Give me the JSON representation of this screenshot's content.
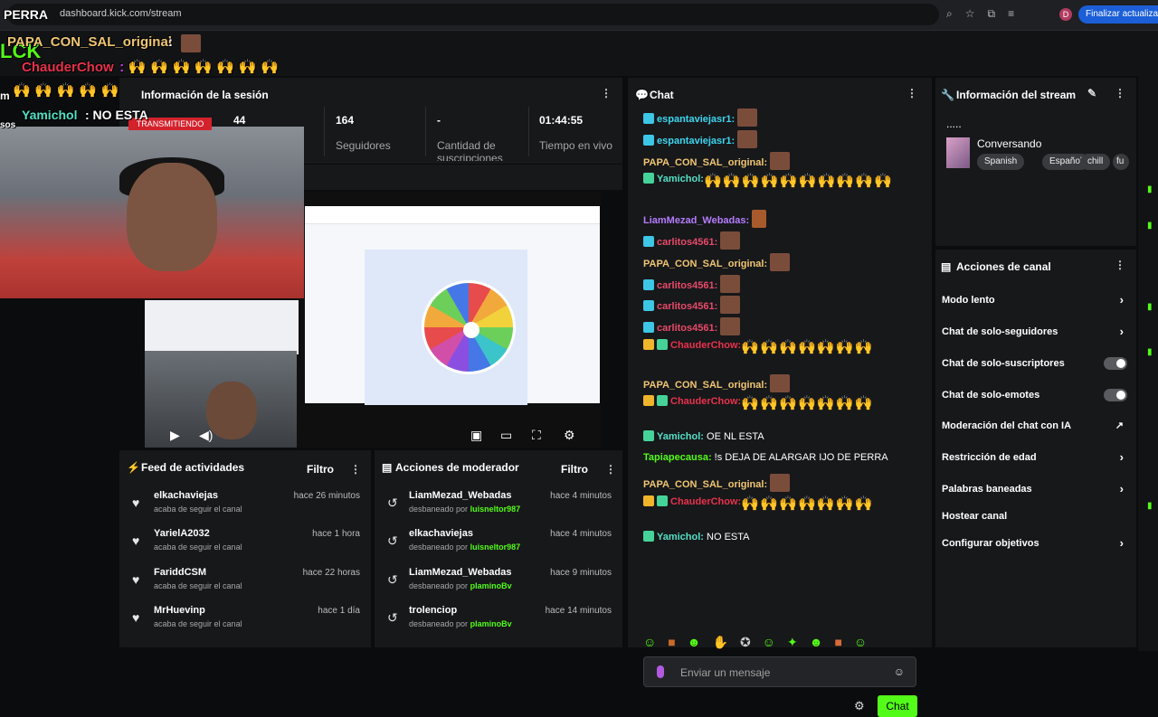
{
  "browser": {
    "url": "dashboard.kick.com/stream",
    "finalize_label": "Finalizar actualizació",
    "avatar_letter": "D"
  },
  "overlay": {
    "line0": "PERRA",
    "line1_user": "PAPA_CON_SAL_original",
    "line2_user": "ChauderChow",
    "line3_user": "Yamichol",
    "line3_text": " : NO ESTA",
    "fragment_lck": "LCK",
    "fragment_m": "m",
    "fragment_sos": "sos"
  },
  "session": {
    "title": "Información de la sesión",
    "status": "TRANSMITIENDO",
    "viewers": "44",
    "followers_value": "164",
    "followers_label": "Seguidores",
    "subs_value": "-",
    "subs_label": "Cantidad de suscripciones",
    "live_value": "01:44:55",
    "live_label": "Tiempo en vivo"
  },
  "feed": {
    "title": "Feed de actividades",
    "filter": "Filtro",
    "items": [
      {
        "name": "elkachaviejas",
        "sub": "acaba de seguir el canal",
        "time": "hace 26 minutos"
      },
      {
        "name": "YarielA2032",
        "sub": "acaba de seguir el canal",
        "time": "hace 1 hora"
      },
      {
        "name": "FariddCSM",
        "sub": "acaba de seguir el canal",
        "time": "hace 22 horas"
      },
      {
        "name": "MrHuevinp",
        "sub": "acaba de seguir el canal",
        "time": "hace 1 día"
      }
    ]
  },
  "mod": {
    "title": "Acciones de moderador",
    "filter": "Filtro",
    "items": [
      {
        "name": "LiamMezad_Webadas",
        "sub": "desbaneado por",
        "by": "luisneltor987",
        "time": "hace 4 minutos"
      },
      {
        "name": "elkachaviejas",
        "sub": "desbaneado por",
        "by": "luisneltor987",
        "time": "hace 4 minutos"
      },
      {
        "name": "LiamMezad_Webadas",
        "sub": "desbaneado por",
        "by": "plaminoBv",
        "time": "hace 9 minutos"
      },
      {
        "name": "trolenciop",
        "sub": "desbaneado por",
        "by": "plaminoBv",
        "time": "hace 14 minutos"
      }
    ]
  },
  "chat": {
    "title": "Chat",
    "input_placeholder": "Enviar un mensaje",
    "send_label": "Chat",
    "messages": [
      {
        "user": "espantaviejasr1:",
        "color": "#3dd6f0"
      },
      {
        "user": "espantaviejasr1:",
        "color": "#3dd6f0"
      },
      {
        "user": "PAPA_CON_SAL_original:",
        "color": "#f0c674"
      },
      {
        "user": "Yamichol:",
        "color": "#53e0c6"
      },
      {
        "user": "LiamMezad_Webadas:",
        "color": "#b57cff"
      },
      {
        "user": "carlitos4561:",
        "color": "#e84a6a"
      },
      {
        "user": "PAPA_CON_SAL_original:",
        "color": "#f0c674"
      },
      {
        "user": "carlitos4561:",
        "color": "#e84a6a"
      },
      {
        "user": "carlitos4561:",
        "color": "#e84a6a"
      },
      {
        "user": "carlitos4561:",
        "color": "#e84a6a"
      },
      {
        "user": "ChauderChow:",
        "color": "#e8324c"
      },
      {
        "user": "PAPA_CON_SAL_original:",
        "color": "#f0c674"
      },
      {
        "user": "ChauderChow:",
        "color": "#e8324c"
      },
      {
        "user": "Yamichol:",
        "color": "#53e0c6",
        "text": " OE NL ESTA"
      },
      {
        "user": "Tapiapecausa:",
        "color": "#53fc18",
        "text": " !s DEJA DE ALARGAR IJO DE PERRA"
      },
      {
        "user": "PAPA_CON_SAL_original:",
        "color": "#f0c674"
      },
      {
        "user": "ChauderChow:",
        "color": "#e8324c"
      },
      {
        "user": "Yamichol:",
        "color": "#53e0c6",
        "text": " NO ESTA"
      }
    ]
  },
  "stream_info": {
    "title": "Información del stream",
    "stream_title": ".....",
    "category": "Conversando",
    "tags": [
      "Spanish",
      "Español",
      "chill",
      "fu"
    ]
  },
  "channel_actions": {
    "title": "Acciones de canal",
    "items": [
      {
        "label": "Modo lento",
        "control": "chevron"
      },
      {
        "label": "Chat de solo-seguidores",
        "control": "chevron"
      },
      {
        "label": "Chat de solo-suscriptores",
        "control": "toggle"
      },
      {
        "label": "Chat de solo-emotes",
        "control": "toggle"
      },
      {
        "label": "Moderación del chat con IA",
        "control": "external"
      },
      {
        "label": "Restricción de edad",
        "control": "chevron"
      },
      {
        "label": "Palabras baneadas",
        "control": "chevron"
      },
      {
        "label": "Hostear canal",
        "control": "none"
      },
      {
        "label": "Configurar objetivos",
        "control": "chevron"
      }
    ]
  },
  "colors": {
    "accent": "#53fc18",
    "live": "#d3222c",
    "panel": "#17181a"
  }
}
